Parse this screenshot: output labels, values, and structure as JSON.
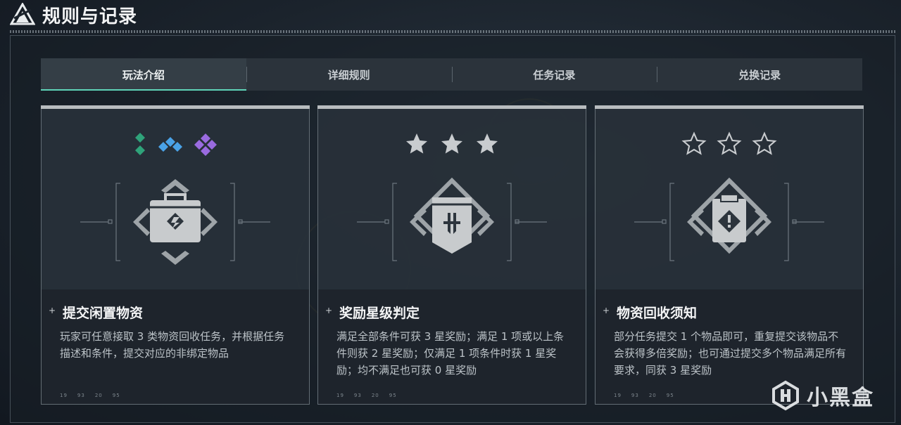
{
  "header": {
    "title": "规则与记录"
  },
  "tabs": [
    {
      "label": "玩法介绍",
      "active": true
    },
    {
      "label": "详细规则",
      "active": false
    },
    {
      "label": "任务记录",
      "active": false
    },
    {
      "label": "兑换记录",
      "active": false
    }
  ],
  "cards": [
    {
      "title": "提交闲置物资",
      "description": "玩家可任意接取 3 类物资回收任务，并根据任务描述和条件，提交对应的非绑定物品",
      "rank_icons": [
        "green-diamond-icon",
        "blue-diamond-icon",
        "purple-diamond-icon"
      ],
      "emblem": "briefcase-icon",
      "foot": [
        "19",
        "93",
        "20",
        "95"
      ]
    },
    {
      "title": "奖励星级判定",
      "description": "满足全部条件可获 3 星奖励；满足 1 项或以上条件则获 2 星奖励；仅满足 1 项条件时获 1 星奖励；均不满足也可获 0 星奖励",
      "rank_icons": [
        "filled-star-icon",
        "filled-star-icon",
        "filled-star-icon"
      ],
      "emblem": "banner-icon",
      "foot": [
        "19",
        "93",
        "20",
        "95"
      ]
    },
    {
      "title": "物资回收须知",
      "description": "部分任务提交 1 个物品即可，重复提交该物品不会获得多倍奖励；也可通过提交多个物品满足所有要求，同获 3 星奖励",
      "rank_icons": [
        "outline-star-icon",
        "outline-star-icon",
        "outline-star-icon"
      ],
      "emblem": "clipboard-warning-icon",
      "foot": [
        "19",
        "93",
        "20",
        "95"
      ]
    }
  ],
  "watermark": {
    "text": "小黑盒"
  },
  "colors": {
    "accent": "#5fd4b8",
    "green": "#2fa37a",
    "blue": "#4aa3e8",
    "purple": "#9a6be0"
  }
}
